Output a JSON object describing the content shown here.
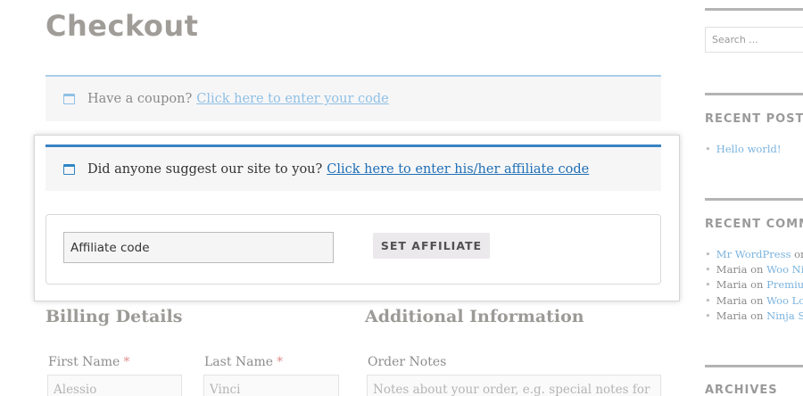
{
  "page": {
    "title": "Checkout"
  },
  "coupon_notice": {
    "text": "Have a coupon?",
    "link": "Click here to enter your code"
  },
  "affiliate_notice": {
    "text": "Did anyone suggest our site to you?",
    "link": "Click here to enter his/her affiliate code"
  },
  "affiliate_form": {
    "input_value": "Affiliate code",
    "button_label": "SET AFFILIATE"
  },
  "billing": {
    "title": "Billing Details",
    "first_name": {
      "label": "First Name",
      "value": "Alessio"
    },
    "last_name": {
      "label": "Last Name",
      "value": "Vinci"
    },
    "required_mark": "*"
  },
  "additional": {
    "title": "Additional Information",
    "order_notes": {
      "label": "Order Notes",
      "placeholder": "Notes about your order, e.g. special notes for"
    }
  },
  "sidebar": {
    "search_placeholder": "Search ...",
    "recent_posts": {
      "heading": "RECENT POSTS",
      "items": [
        "Hello world!"
      ]
    },
    "recent_comments": {
      "heading": "RECENT COMM",
      "items": [
        {
          "author": "Mr WordPress",
          "sep": "on",
          "post": ""
        },
        {
          "author": "Maria",
          "sep": "on",
          "post": "Woo Nin"
        },
        {
          "author": "Maria",
          "sep": "on",
          "post": "Premium"
        },
        {
          "author": "Maria",
          "sep": "on",
          "post": "Woo Log"
        },
        {
          "author": "Maria",
          "sep": "on",
          "post": "Ninja Sil"
        }
      ]
    },
    "archives": {
      "heading": "ARCHIVES"
    }
  },
  "colors": {
    "accent": "#3a83c4",
    "link": "#1f6fb5",
    "notice_bg": "#f7f6f7"
  }
}
